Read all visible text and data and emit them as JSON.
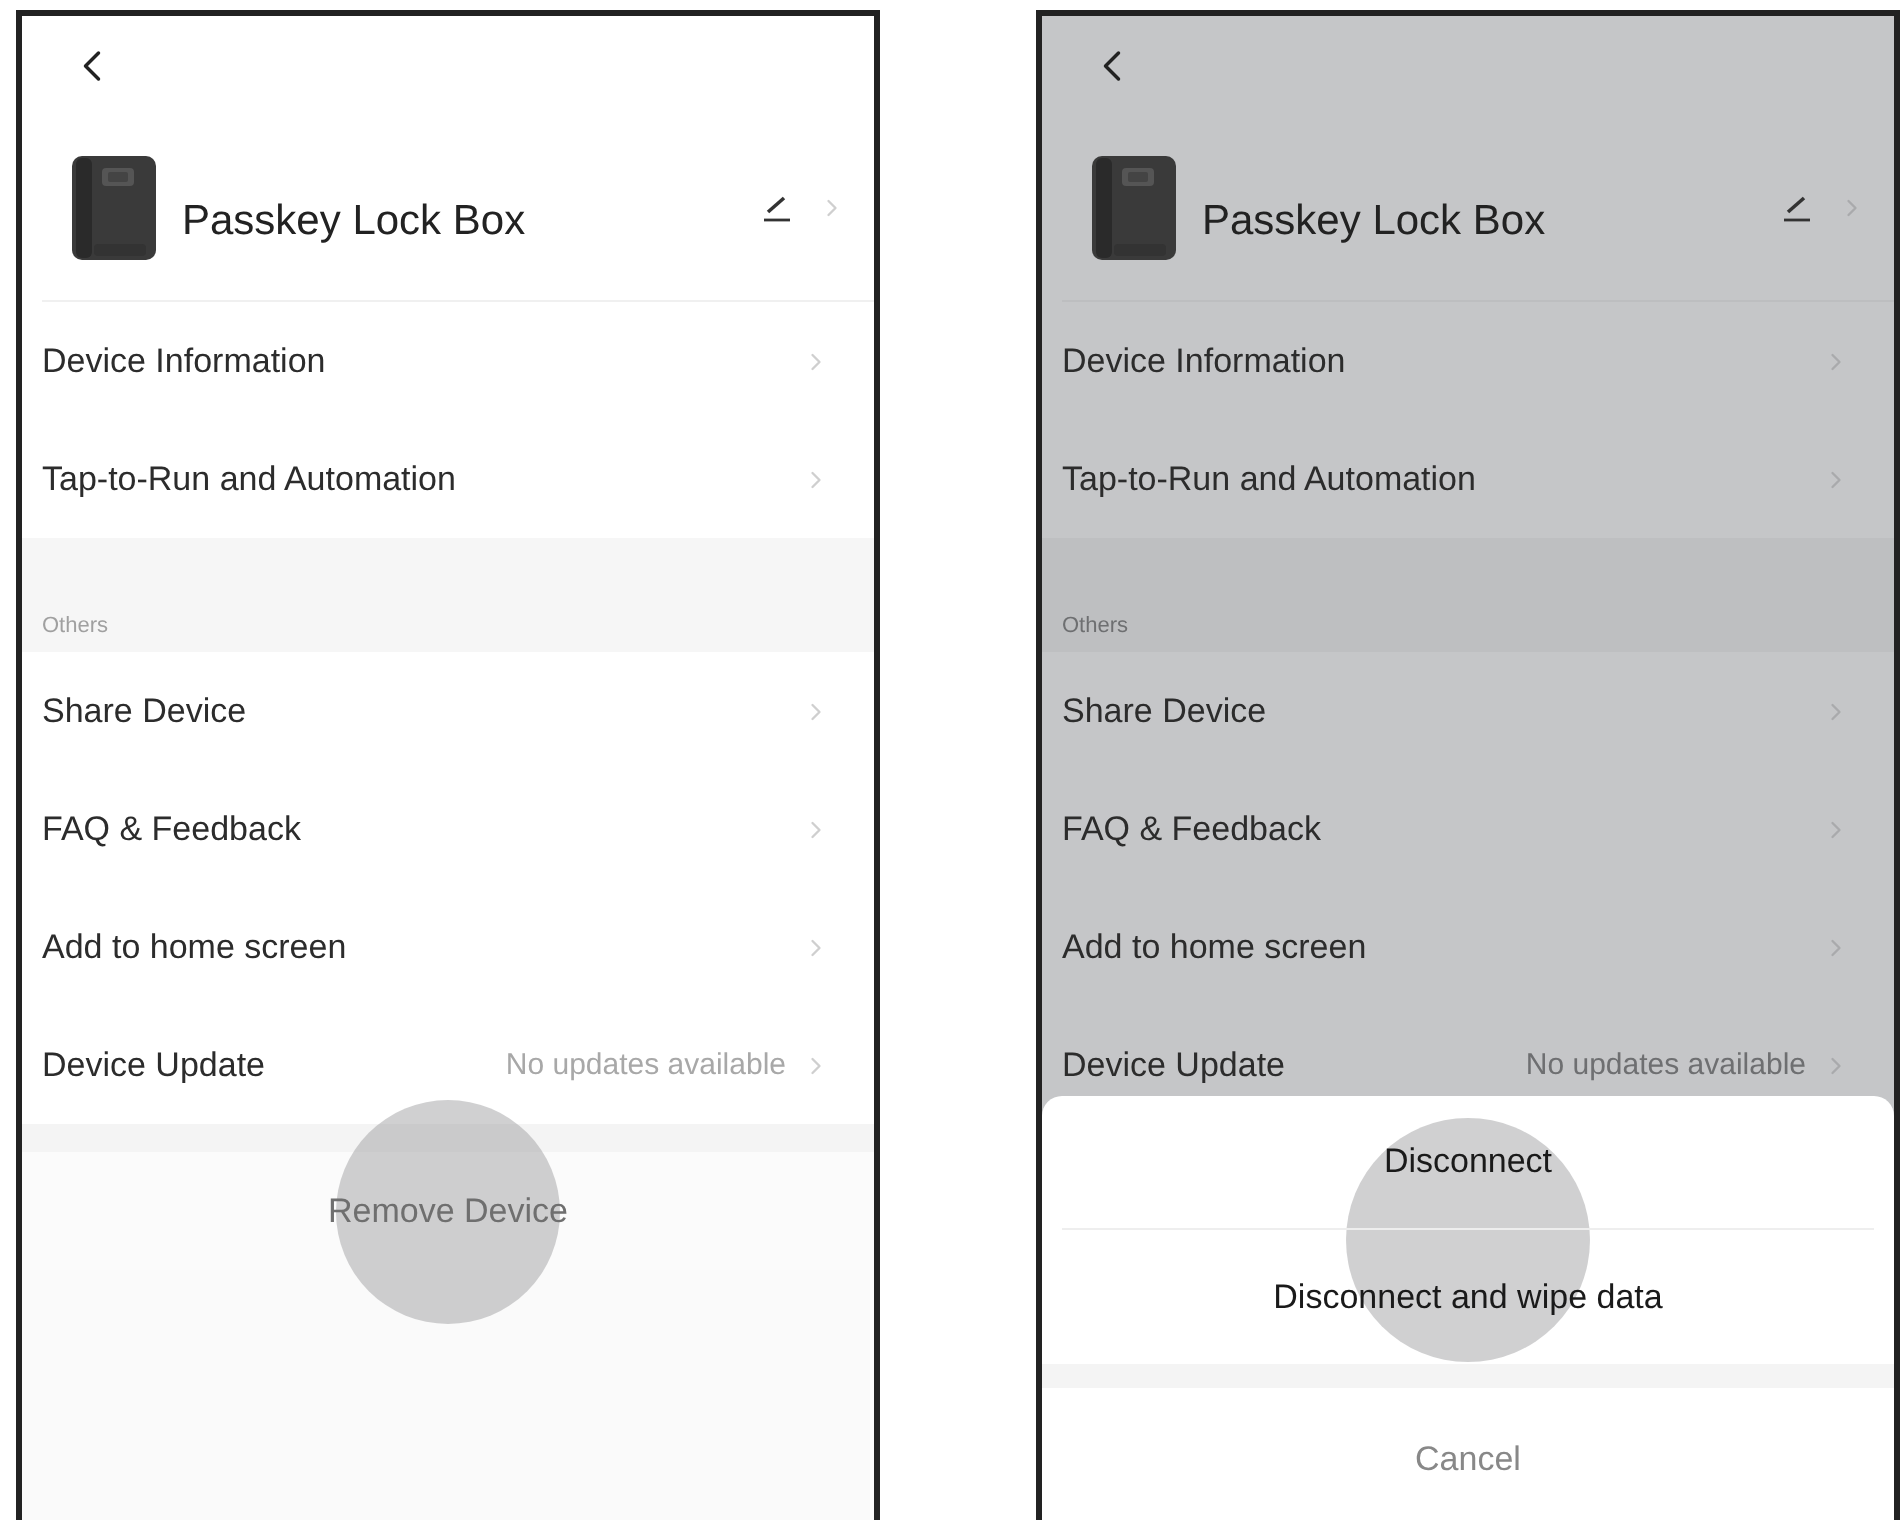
{
  "screens": [
    {
      "dimmed": false,
      "device": {
        "name": "Passkey Lock Box"
      },
      "sections": [
        {
          "items": [
            {
              "label": "Device Information"
            },
            {
              "label": "Tap-to-Run and Automation"
            }
          ]
        },
        {
          "title": "Others",
          "items": [
            {
              "label": "Share Device"
            },
            {
              "label": "FAQ & Feedback"
            },
            {
              "label": "Add to home screen"
            },
            {
              "label": "Device Update",
              "value": "No updates available"
            }
          ]
        }
      ],
      "remove_button": {
        "label": "Remove Device",
        "touched": true
      }
    },
    {
      "dimmed": true,
      "device": {
        "name": "Passkey Lock Box"
      },
      "sections": [
        {
          "items": [
            {
              "label": "Device Information"
            },
            {
              "label": "Tap-to-Run and Automation"
            }
          ]
        },
        {
          "title": "Others",
          "items": [
            {
              "label": "Share Device"
            },
            {
              "label": "FAQ & Feedback"
            },
            {
              "label": "Add to home screen"
            },
            {
              "label": "Device Update",
              "value": "No updates available"
            }
          ]
        }
      ],
      "action_sheet": {
        "touched": true,
        "options": [
          {
            "label": "Disconnect"
          },
          {
            "label": "Disconnect and wipe data"
          }
        ],
        "cancel": "Cancel"
      }
    }
  ]
}
